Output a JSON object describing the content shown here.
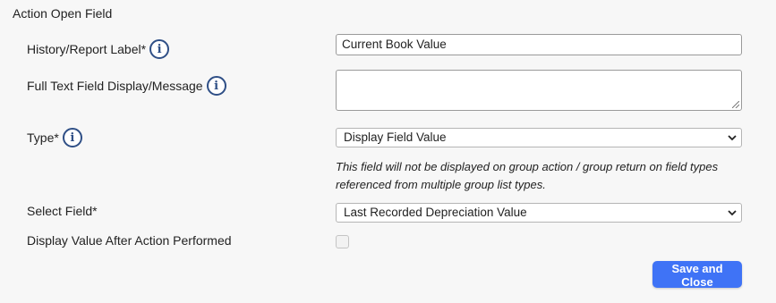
{
  "section_title": "Action Open Field",
  "fields": {
    "history_label": {
      "label": "History/Report Label*",
      "value": "Current Book Value",
      "icon": "info-icon"
    },
    "full_text": {
      "label": "Full Text Field Display/Message",
      "value": "",
      "icon": "info-icon"
    },
    "type": {
      "label": "Type*",
      "selected": "Display Field Value",
      "icon": "info-icon",
      "note": "This field will not be displayed on group action / group return on field types referenced from multiple group list types."
    },
    "select_field": {
      "label": "Select Field*",
      "selected": "Last Recorded Depreciation Value"
    },
    "display_after_action": {
      "label": "Display Value After Action Performed",
      "checked": false
    }
  },
  "buttons": {
    "save_close": "Save and Close"
  },
  "colors": {
    "accent": "#3f73f6",
    "icon": "#2f4f86",
    "background": "#f7f7f7"
  }
}
